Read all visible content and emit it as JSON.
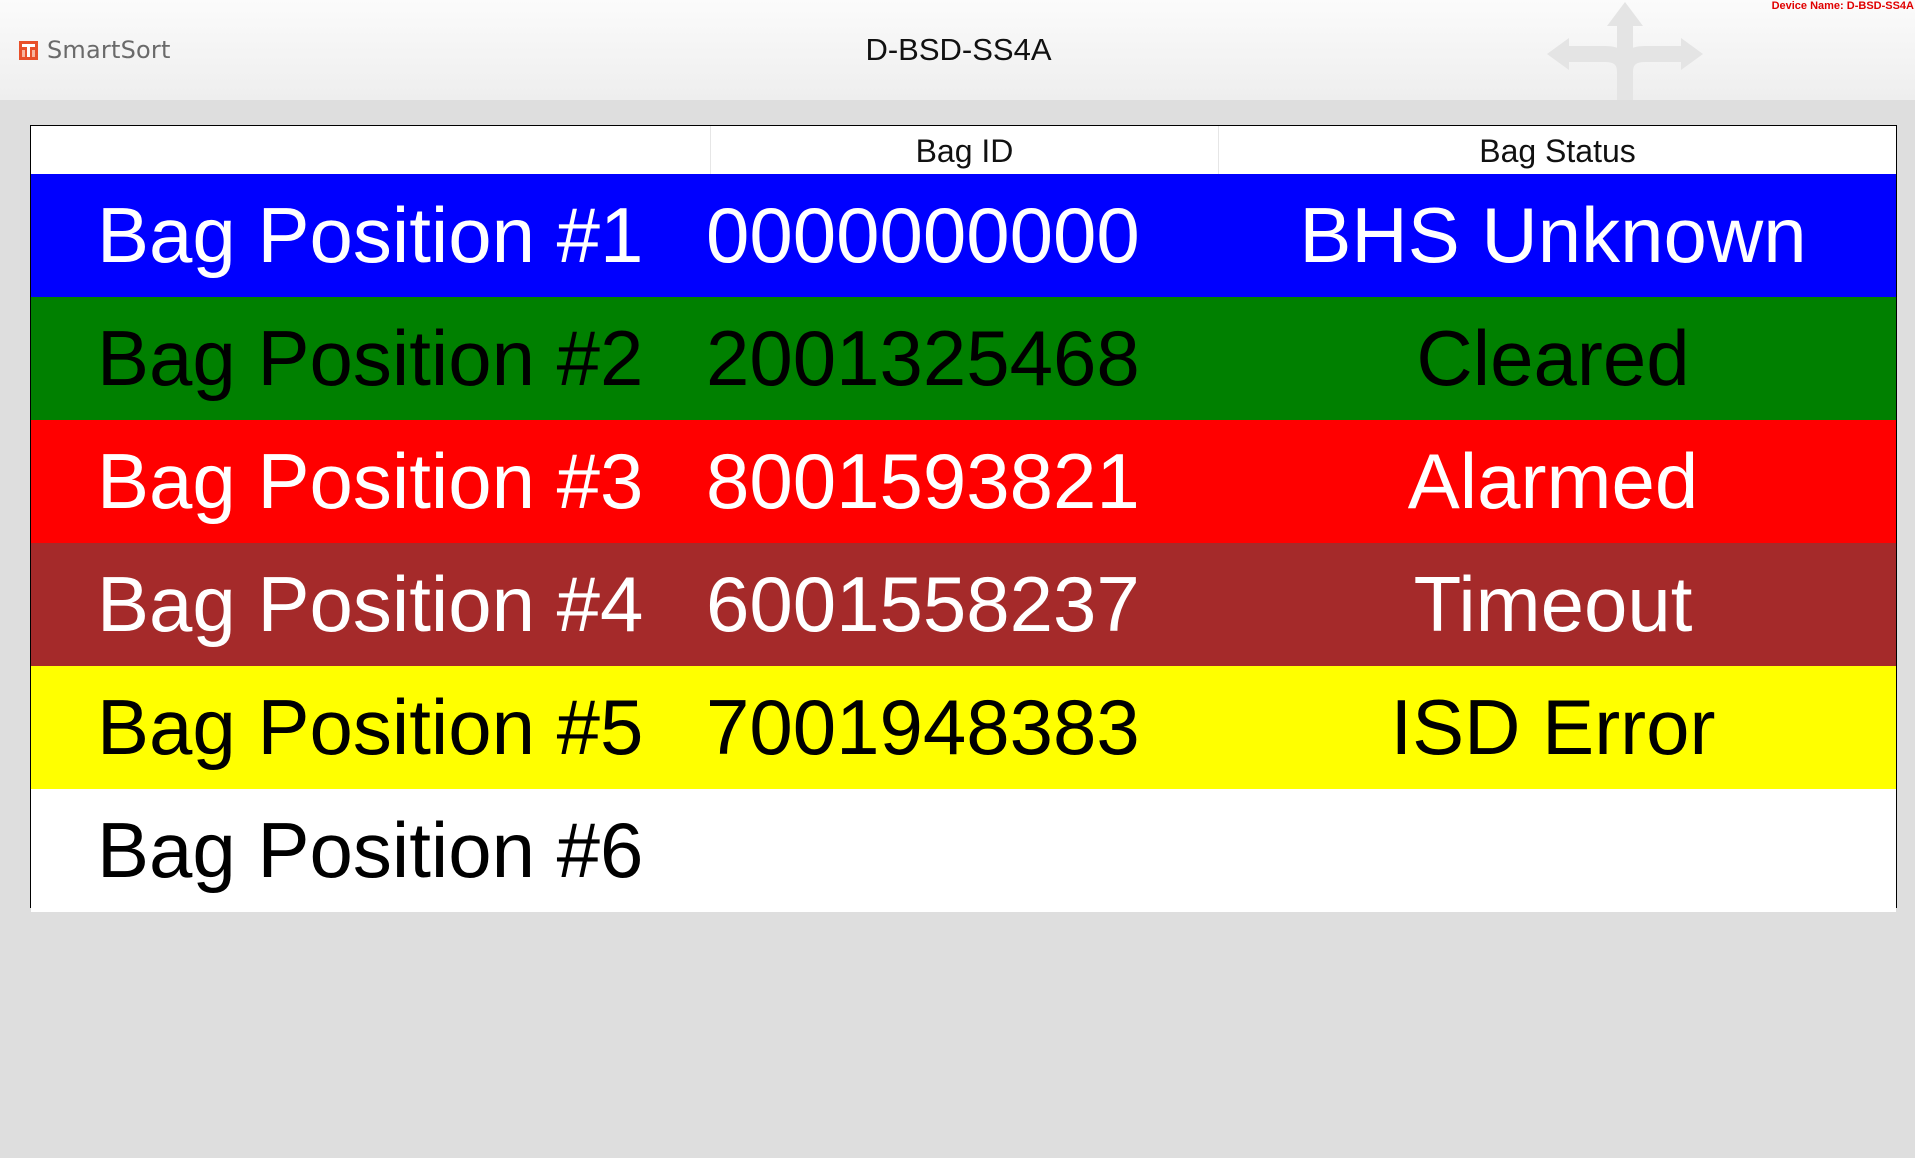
{
  "app": {
    "brand": "SmartSort",
    "title": "D-BSD-SS4A",
    "device_name": "Device Name: D-BSD-SS4A"
  },
  "colors": {
    "brand_accent": "#e8502a",
    "device_name_text": "#e00000",
    "header_bg": "#f4f4f4",
    "page_bg": "#dedede"
  },
  "table": {
    "headers": [
      "",
      "Bag ID",
      "Bag Status"
    ],
    "rows": [
      {
        "position": "Bag Position #1",
        "bag_id": "0000000000",
        "status": "BHS Unknown",
        "bg": "#0000ff",
        "fg": "#ffffff"
      },
      {
        "position": "Bag Position #2",
        "bag_id": "2001325468",
        "status": "Cleared",
        "bg": "#008000",
        "fg": "#000000"
      },
      {
        "position": "Bag Position #3",
        "bag_id": "8001593821",
        "status": "Alarmed",
        "bg": "#ff0000",
        "fg": "#ffffff"
      },
      {
        "position": "Bag Position #4",
        "bag_id": "6001558237",
        "status": "Timeout",
        "bg": "#a52a2a",
        "fg": "#ffffff"
      },
      {
        "position": "Bag Position #5",
        "bag_id": "7001948383",
        "status": "ISD Error",
        "bg": "#ffff00",
        "fg": "#000000"
      },
      {
        "position": "Bag Position #6",
        "bag_id": "",
        "status": "",
        "bg": "#ffffff",
        "fg": "#000000"
      }
    ]
  },
  "icons": {
    "brand_logo": "smartsort-logo-icon",
    "background_decoration": "directional-arrows-icon"
  }
}
